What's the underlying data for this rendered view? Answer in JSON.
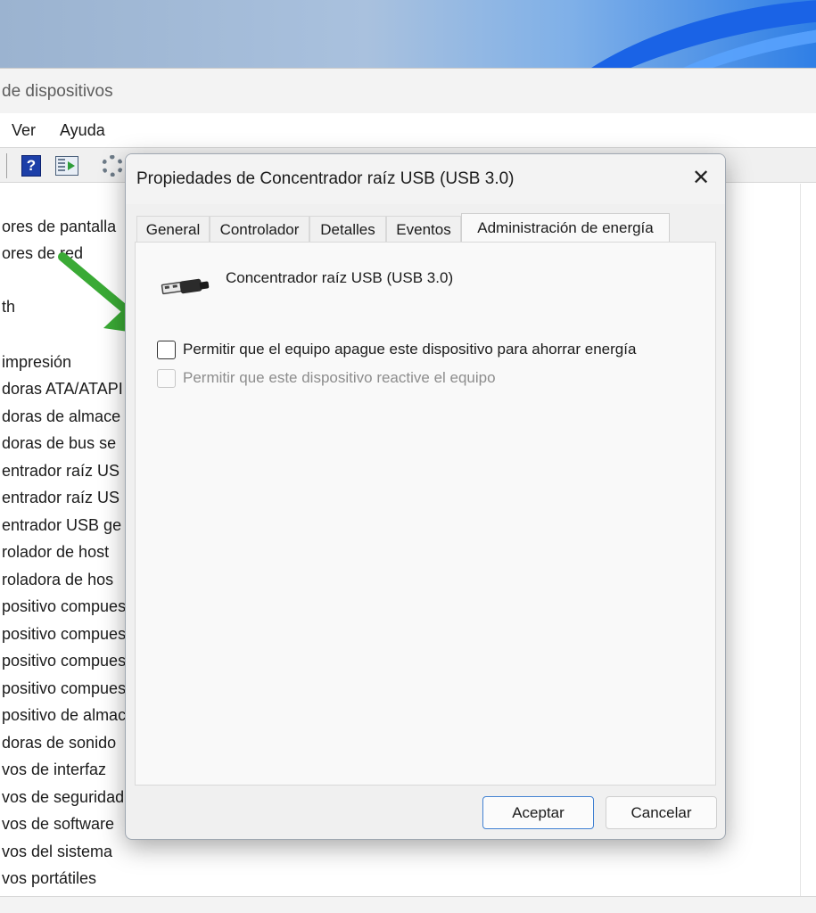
{
  "window": {
    "title": "de dispositivos",
    "menu": [
      "Ver",
      "Ayuda"
    ],
    "tree_items": [
      "ores de pantalla",
      "ores de red",
      "th",
      "impresión",
      "doras ATA/ATAPI",
      "doras de almace",
      "doras de bus se",
      "entrador raíz US",
      "entrador raíz US",
      "entrador USB ge",
      "rolador de host",
      "roladora de hos",
      "positivo compues",
      "positivo compues",
      "positivo compues",
      "positivo compues",
      "positivo de almac",
      "doras de sonido",
      "vos de interfaz",
      "vos de seguridad",
      "vos de software",
      "vos del sistema",
      "vos portátiles"
    ]
  },
  "dialog": {
    "title": "Propiedades de Concentrador raíz USB (USB 3.0)",
    "close_glyph": "✕",
    "tabs": [
      "General",
      "Controlador",
      "Detalles",
      "Eventos",
      "Administración de energía"
    ],
    "active_tab": "Administración de energía",
    "device_name": "Concentrador raíz USB (USB 3.0)",
    "device_icon": "usb-plug-icon",
    "options": [
      {
        "label": "Permitir que el equipo apague este dispositivo para ahorrar energía",
        "checked": false,
        "enabled": true
      },
      {
        "label": "Permitir que este dispositivo reactive el equipo",
        "checked": false,
        "enabled": false
      }
    ],
    "ok_label": "Aceptar",
    "cancel_label": "Cancelar"
  },
  "annotation": {
    "type": "arrow",
    "color": "#3aaa35"
  }
}
